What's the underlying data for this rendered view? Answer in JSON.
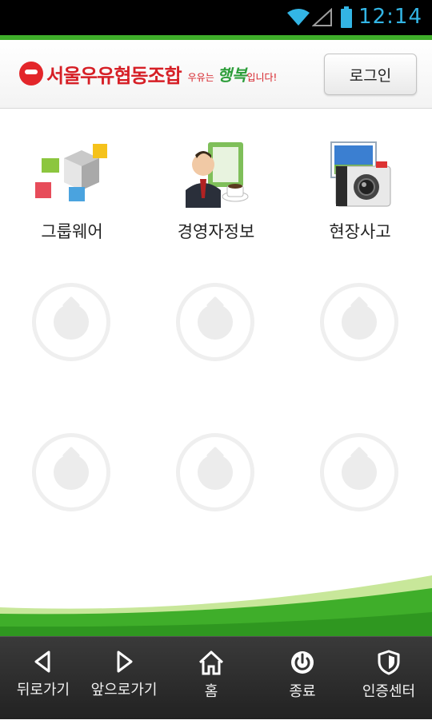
{
  "status_bar": {
    "time": "12:14",
    "icons": [
      "wifi-icon",
      "signal-icon",
      "battery-icon"
    ]
  },
  "header": {
    "logo_name": "서울우유협동조합",
    "logo_slogan_prefix": "우유는",
    "logo_slogan_happy": "행복",
    "logo_slogan_suffix": "입니다!",
    "login_label": "로그인"
  },
  "apps": [
    {
      "label": "그룹웨어",
      "icon": "groupware-cubes-icon"
    },
    {
      "label": "경영자정보",
      "icon": "executive-info-icon"
    },
    {
      "label": "현장사고",
      "icon": "field-accident-camera-icon"
    }
  ],
  "empty_slot_count": 6,
  "bottom_nav": [
    {
      "label": "뒤로가기",
      "icon": "back-arrow-icon"
    },
    {
      "label": "앞으로가기",
      "icon": "forward-arrow-icon"
    },
    {
      "label": "홈",
      "icon": "home-icon"
    },
    {
      "label": "종료",
      "icon": "power-icon"
    },
    {
      "label": "인증센터",
      "icon": "shield-icon"
    }
  ],
  "colors": {
    "brand_red": "#d61f26",
    "brand_green": "#3fae2a",
    "status_blue": "#33b5e5"
  }
}
